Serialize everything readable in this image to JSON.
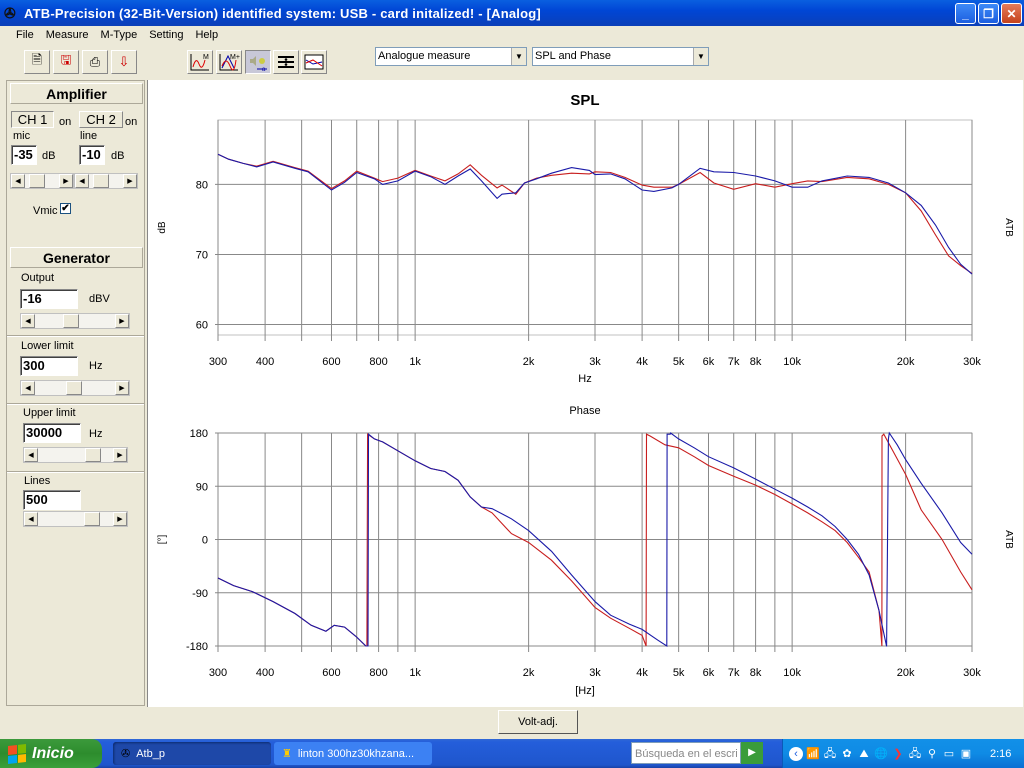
{
  "window": {
    "title": "ATB-Precision  (32-Bit-Version)  identified system: USB - card  initalized! - [Analog]",
    "app_icon": "atb-app-icon",
    "buttons": [
      "minimize",
      "restore",
      "close"
    ]
  },
  "menu": [
    "File",
    "Measure",
    "M-Type",
    "Setting",
    "Help"
  ],
  "toolbar": {
    "left_buttons": [
      "new-document-icon",
      "save-icon",
      "print-icon",
      "export-icon"
    ],
    "mode_buttons": [
      "measure-icon",
      "measure-plus-icon",
      "speaker-adjust-icon",
      "settings-list-icon",
      "graph-view-icon"
    ],
    "measure_type": "Analogue measure",
    "display_type": "SPL and Phase"
  },
  "amplifier": {
    "title": "Amplifier",
    "ch1": {
      "label": "CH 1",
      "state": "on",
      "input": "mic",
      "value": "-35",
      "unit": "dB"
    },
    "ch2": {
      "label": "CH 2",
      "state": "on",
      "input": "line",
      "value": "-10",
      "unit": "dB"
    },
    "vmic_label": "Vmic",
    "vmic_checked": true,
    "vmic_mark": "✔"
  },
  "generator": {
    "title": "Generator",
    "output": {
      "label": "Output",
      "value": "-16",
      "unit": "dBV",
      "slider": 0.45
    },
    "lower": {
      "label": "Lower limit",
      "value": "300",
      "unit": "Hz",
      "slider": 0.5
    },
    "upper": {
      "label": "Upper limit",
      "value": "30000",
      "unit": "Hz",
      "slider": 0.82
    },
    "lines": {
      "label": "Lines",
      "value": "500",
      "slider": 0.8
    }
  },
  "bottom": {
    "volt_adj": "Volt-adj."
  },
  "taskbar": {
    "start": "Inicio",
    "tasks": [
      "Atb_p",
      "linton 300hz30khzana..."
    ],
    "search_placeholder": "Búsqueda en el escri",
    "clock": "2:16"
  },
  "chart_data": [
    {
      "type": "line",
      "title": "SPL",
      "xlabel": "Hz",
      "ylabel": "dB",
      "side_label": "ATB",
      "xscale": "log",
      "xlim": [
        300,
        30000
      ],
      "ylim": [
        58.5,
        89.2
      ],
      "yticks": [
        60,
        70,
        80
      ],
      "xticks": [
        300,
        400,
        600,
        800,
        1000,
        2000,
        3000,
        4000,
        5000,
        6000,
        7000,
        8000,
        10000,
        20000,
        30000
      ],
      "xtick_labels": [
        "300",
        "400",
        "600",
        "800",
        "1k",
        "2k",
        "3k",
        "4k",
        "5k",
        "6k",
        "7k",
        "8k",
        "10k",
        "20k",
        "30k"
      ],
      "xgrid": [
        300,
        400,
        500,
        600,
        700,
        800,
        900,
        1000,
        2000,
        3000,
        4000,
        5000,
        6000,
        7000,
        8000,
        9000,
        10000,
        20000,
        30000
      ],
      "grid": true,
      "series": [
        {
          "name": "blue",
          "color": "#1a1aa8",
          "x": [
            300,
            320,
            350,
            380,
            420,
            480,
            520,
            600,
            650,
            700,
            780,
            820,
            900,
            1000,
            1100,
            1200,
            1300,
            1400,
            1500,
            1650,
            1700,
            1850,
            1950,
            2100,
            2300,
            2600,
            2900,
            3000,
            3300,
            3600,
            4000,
            4300,
            4800,
            5000,
            5700,
            6200,
            7000,
            8000,
            9000,
            10000,
            11000,
            12000,
            14000,
            16000,
            18000,
            20000,
            22000,
            24000,
            26000,
            28000,
            30000
          ],
          "y": [
            84.3,
            83.6,
            83.0,
            82.5,
            83.2,
            82.3,
            81.8,
            79.2,
            80.3,
            81.7,
            80.8,
            80.0,
            80.5,
            81.9,
            81.1,
            80.0,
            81.2,
            82.2,
            80.5,
            78.0,
            78.6,
            78.8,
            80.2,
            80.8,
            81.6,
            82.4,
            82.0,
            81.4,
            81.5,
            80.8,
            79.2,
            79.0,
            79.5,
            80.0,
            82.3,
            81.8,
            81.7,
            81.2,
            80.5,
            79.6,
            79.6,
            80.5,
            81.2,
            81.0,
            80.2,
            78.8,
            77.0,
            74.2,
            71.0,
            68.6,
            67.2
          ]
        },
        {
          "name": "red",
          "color": "#c81e1e",
          "x": [
            300,
            320,
            350,
            380,
            420,
            480,
            520,
            600,
            650,
            700,
            780,
            820,
            900,
            1000,
            1100,
            1200,
            1300,
            1400,
            1500,
            1650,
            1700,
            1850,
            1950,
            2100,
            2300,
            2600,
            2900,
            3000,
            3300,
            3600,
            4000,
            4300,
            4800,
            5000,
            5700,
            6200,
            7000,
            8000,
            9000,
            10000,
            11000,
            12000,
            14000,
            16000,
            18000,
            20000,
            22000,
            24000,
            26000,
            28000,
            30000
          ],
          "y": [
            84.3,
            83.6,
            83.0,
            82.6,
            83.3,
            82.4,
            81.9,
            79.4,
            80.5,
            81.9,
            80.9,
            80.4,
            80.9,
            82.0,
            81.2,
            80.5,
            81.5,
            82.8,
            81.3,
            79.5,
            79.9,
            78.6,
            80.2,
            80.9,
            81.3,
            81.6,
            81.5,
            81.8,
            81.7,
            81.0,
            79.9,
            79.6,
            79.6,
            80.0,
            81.7,
            80.2,
            79.3,
            80.1,
            79.6,
            80.1,
            80.5,
            80.4,
            81.0,
            80.8,
            80.0,
            78.8,
            76.2,
            72.8,
            69.8,
            68.4,
            67.3
          ]
        }
      ]
    },
    {
      "type": "line",
      "title": "Phase",
      "xlabel": "[Hz]",
      "ylabel": "[°]",
      "side_label": "ATB",
      "xscale": "log",
      "xlim": [
        300,
        30000
      ],
      "ylim": [
        -180,
        180
      ],
      "yticks": [
        -180,
        -90,
        0,
        90,
        180
      ],
      "xticks": [
        300,
        400,
        600,
        800,
        1000,
        2000,
        3000,
        4000,
        5000,
        6000,
        7000,
        8000,
        10000,
        20000,
        30000
      ],
      "xtick_labels": [
        "300",
        "400",
        "600",
        "800",
        "1k",
        "2k",
        "3k",
        "4k",
        "5k",
        "6k",
        "7k",
        "8k",
        "10k",
        "20k",
        "30k"
      ],
      "xgrid": [
        300,
        400,
        500,
        600,
        700,
        800,
        900,
        1000,
        2000,
        3000,
        4000,
        5000,
        6000,
        7000,
        8000,
        9000,
        10000,
        20000,
        30000
      ],
      "grid": true,
      "series": [
        {
          "name": "blue",
          "color": "#1a1aa8",
          "x": [
            300,
            330,
            370,
            420,
            480,
            530,
            580,
            610,
            650,
            700,
            740,
            750,
            752,
            780,
            820,
            900,
            1000,
            1100,
            1200,
            1300,
            1400,
            1500,
            1600,
            1800,
            2000,
            2300,
            2600,
            3000,
            3300,
            3700,
            4000,
            4400,
            4650,
            4660,
            4750,
            4760,
            5000,
            5500,
            6000,
            7000,
            8000,
            9000,
            10000,
            11000,
            12000,
            13000,
            14000,
            15000,
            16000,
            17000,
            17800,
            17810,
            18000,
            18100,
            19000,
            20000,
            22000,
            25000,
            28000,
            30000
          ],
          "y": [
            -65,
            -78,
            -88,
            -105,
            -125,
            -145,
            -155,
            -145,
            -148,
            -165,
            -180,
            -180,
            178,
            170,
            165,
            150,
            133,
            120,
            115,
            100,
            72,
            55,
            52,
            35,
            15,
            -20,
            -60,
            -105,
            -128,
            -143,
            -152,
            -170,
            -180,
            178,
            178,
            180,
            170,
            155,
            140,
            121,
            102,
            85,
            70,
            55,
            40,
            22,
            0,
            -25,
            -60,
            -120,
            -180,
            -180,
            170,
            180,
            160,
            135,
            95,
            45,
            -5,
            -25
          ]
        },
        {
          "name": "red",
          "color": "#c81e1e",
          "x": [
            300,
            330,
            370,
            420,
            480,
            530,
            580,
            610,
            650,
            700,
            740,
            745,
            748,
            780,
            820,
            900,
            1000,
            1100,
            1200,
            1300,
            1400,
            1500,
            1600,
            1800,
            2000,
            2300,
            2600,
            3000,
            3300,
            3700,
            4000,
            4100,
            4110,
            4200,
            4600,
            5000,
            5500,
            6000,
            7000,
            8000,
            9000,
            10000,
            11000,
            12000,
            13000,
            14000,
            15000,
            16000,
            17000,
            17300,
            17310,
            17500,
            18500,
            20000,
            22000,
            25000,
            28000,
            30000
          ],
          "y": [
            -65,
            -78,
            -88,
            -105,
            -125,
            -145,
            -155,
            -145,
            -148,
            -165,
            -180,
            -180,
            178,
            170,
            165,
            150,
            133,
            120,
            115,
            100,
            72,
            55,
            45,
            10,
            -5,
            -35,
            -70,
            -115,
            -133,
            -150,
            -162,
            -180,
            178,
            175,
            160,
            155,
            140,
            125,
            107,
            92,
            76,
            60,
            45,
            30,
            15,
            -5,
            -30,
            -55,
            -120,
            -180,
            175,
            178,
            150,
            110,
            50,
            0,
            -55,
            -85
          ]
        }
      ]
    }
  ]
}
